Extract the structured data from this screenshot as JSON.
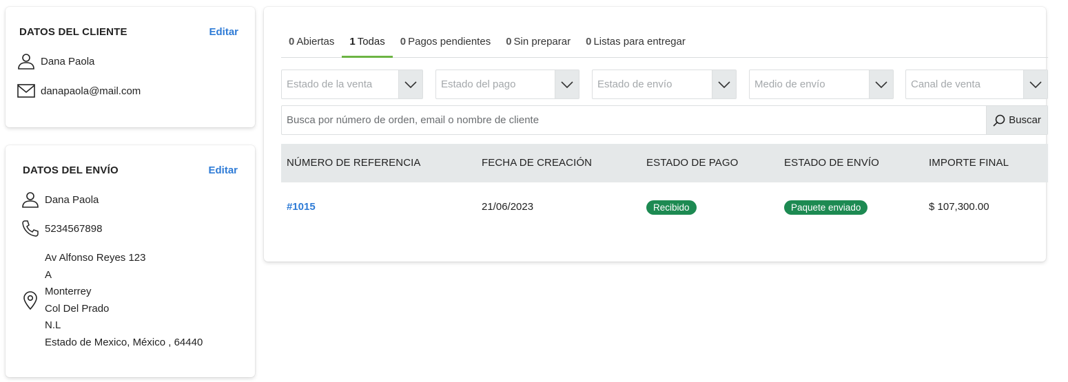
{
  "client": {
    "title": "DATOS DEL CLIENTE",
    "edit_label": "Editar",
    "name": "Dana Paola",
    "email": "danapaola@mail.com"
  },
  "shipping": {
    "title": "DATOS DEL ENVÍO",
    "edit_label": "Editar",
    "name": "Dana Paola",
    "phone": "5234567898",
    "address_lines": [
      "Av Alfonso Reyes 123",
      "A",
      "Monterrey",
      "Col Del Prado",
      "N.L",
      "Estado de Mexico, México , 64440"
    ]
  },
  "tabs": [
    {
      "count": "0",
      "label": "Abiertas"
    },
    {
      "count": "1",
      "label": "Todas"
    },
    {
      "count": "0",
      "label": "Pagos pendientes"
    },
    {
      "count": "0",
      "label": "Sin preparar"
    },
    {
      "count": "0",
      "label": "Listas para entregar"
    }
  ],
  "active_tab": "Todas",
  "filters": [
    {
      "placeholder": "Estado de la venta"
    },
    {
      "placeholder": "Estado del pago"
    },
    {
      "placeholder": "Estado de envío"
    },
    {
      "placeholder": "Medio de envío"
    },
    {
      "placeholder": "Canal de venta"
    }
  ],
  "search": {
    "placeholder": "Busca por número de orden, email o nombre de cliente",
    "button_label": "Buscar"
  },
  "table": {
    "headers": [
      "NÚMERO DE REFERENCIA",
      "FECHA DE CREACIÓN",
      "ESTADO DE PAGO",
      "ESTADO DE ENVÍO",
      "IMPORTE FINAL"
    ],
    "rows": [
      {
        "reference": "#1015",
        "created": "21/06/2023",
        "payment_status": "Recibido",
        "shipping_status": "Paquete enviado",
        "total": "$ 107,300.00"
      }
    ]
  },
  "colors": {
    "link": "#2e7bd6",
    "active_tab": "#6cb443",
    "badge": "#1d8a52"
  }
}
